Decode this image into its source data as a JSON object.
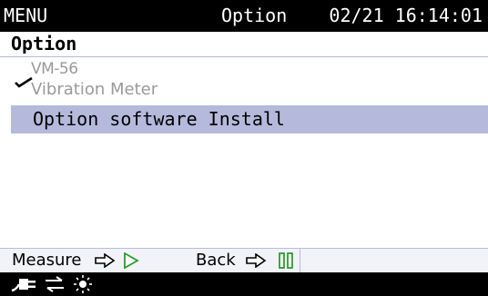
{
  "topbar": {
    "menu_label": "MENU",
    "title": "Option",
    "datetime": "02/21 16:14:01"
  },
  "header": {
    "label": "Option"
  },
  "option_item": {
    "code": "VM-56",
    "name": "Vibration Meter",
    "checked": true,
    "check_icon": "checkmark-icon"
  },
  "install_item": {
    "label": "Option software Install",
    "selected": true,
    "highlight_color": "#b5badd"
  },
  "help": {
    "measure_label": "Measure",
    "measure_icon": "play-icon",
    "back_label": "Back",
    "back_icon": "pause-icon",
    "arrow_icon": "right-arrow-icon",
    "icon_color": "#2e9a2e"
  },
  "status": {
    "icons": [
      "power-plug-icon",
      "usb-transfer-icon",
      "backlight-icon"
    ]
  }
}
